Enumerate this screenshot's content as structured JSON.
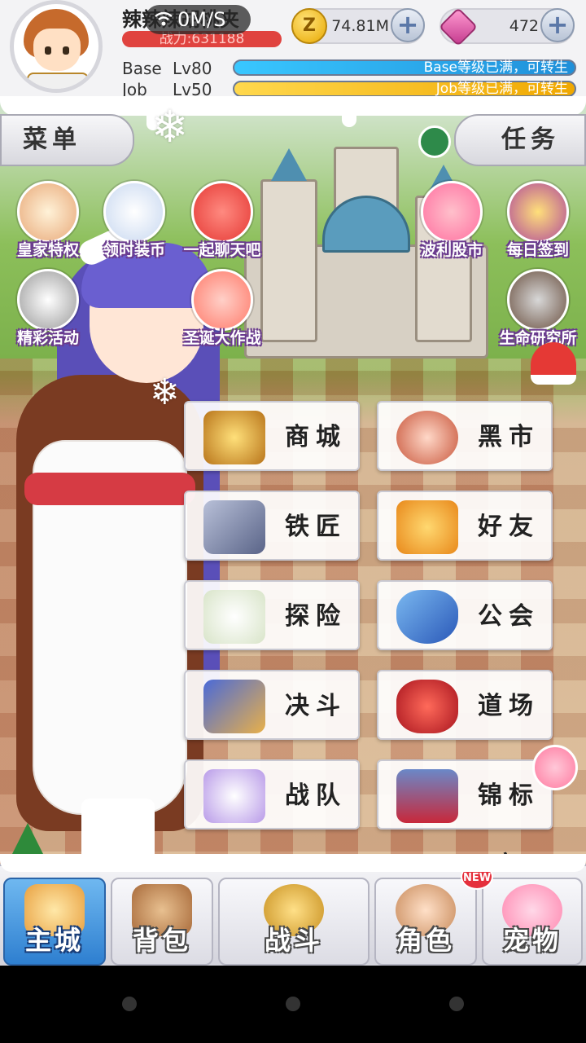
{
  "player": {
    "name": "辣辣辣胡桃夹",
    "power": "战力:631188"
  },
  "overlay": {
    "speed": "0M/S"
  },
  "currency": {
    "gold": "74.81M",
    "gold_icon": "coin-icon",
    "gems": "472",
    "gem_icon": "gem-icon"
  },
  "levels": {
    "base_label": "Base",
    "base_level": "Lv80",
    "base_status": "Base等级已满，可转生",
    "job_label": "Job",
    "job_level": "Lv50",
    "job_status": "Job等级已满，可转生",
    "base_fill": 1.0,
    "job_fill": 1.0
  },
  "tabs": {
    "menu": "菜单",
    "task": "任务"
  },
  "features": [
    {
      "label": "皇家特权",
      "icon": "royal-privilege-icon"
    },
    {
      "label": "领时装币",
      "icon": "costume-coin-icon"
    },
    {
      "label": "一起聊天吧",
      "icon": "chat-bubble-icon"
    },
    {
      "label": "波利股市",
      "icon": "poring-stock-icon"
    },
    {
      "label": "每日签到",
      "icon": "daily-gift-icon"
    },
    {
      "label": "精彩活动",
      "icon": "event-icon"
    },
    {
      "label": "圣诞大作战",
      "icon": "christmas-battle-icon"
    },
    {
      "label": "生命研究所",
      "icon": "life-lab-icon"
    }
  ],
  "menu": {
    "shop": "商城",
    "black_market": "黑市",
    "smith": "铁匠",
    "friends": "好友",
    "explore": "探险",
    "guild": "公会",
    "duel": "决斗",
    "dojo": "道场",
    "team": "战队",
    "tournament": "锦标赛"
  },
  "nav": {
    "city": "主城",
    "bag": "背包",
    "battle": "战斗",
    "character": "角色",
    "pet": "宠物",
    "new_badge": "NEW"
  },
  "colors": {
    "base_bar": "#1f8fd9",
    "job_bar": "#f0a800",
    "power_bar": "#e0433f",
    "active_nav": "#2e7fd0"
  }
}
